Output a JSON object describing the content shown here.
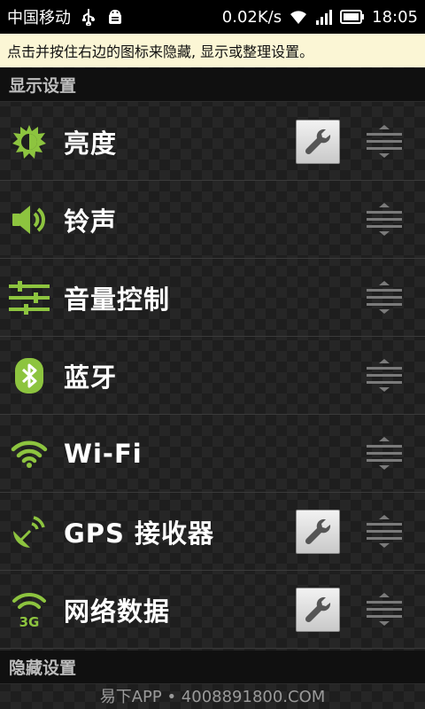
{
  "status_bar": {
    "carrier": "中国移动",
    "usb_icon": "usb-icon",
    "debug_icon": "android-debug-icon",
    "net_speed": "0.02K/s",
    "wifi_icon": "wifi-signal-icon",
    "signal_icon": "cell-signal-icon",
    "battery_icon": "battery-icon",
    "time": "18:05"
  },
  "hint": "点击并按住右边的图标来隐藏, 显示或整理设置。",
  "sections": {
    "display": "显示设置",
    "hidden": "隐藏设置"
  },
  "items": [
    {
      "label": "亮度",
      "icon": "brightness-icon",
      "has_settings": true
    },
    {
      "label": "铃声",
      "icon": "volume-icon",
      "has_settings": false
    },
    {
      "label": "音量控制",
      "icon": "volume-sliders-icon",
      "has_settings": false
    },
    {
      "label": "蓝牙",
      "icon": "bluetooth-icon",
      "has_settings": false
    },
    {
      "label": "Wi-Fi",
      "icon": "wifi-icon",
      "has_settings": false
    },
    {
      "label": "GPS 接收器",
      "icon": "gps-dish-icon",
      "has_settings": true
    },
    {
      "label": "网络数据",
      "icon": "3g-data-icon",
      "has_settings": true
    }
  ],
  "watermark": "易下APP • 4008891800.COM",
  "colors": {
    "accent_green": "#8dc43f",
    "hint_background": "#fbf6d5",
    "header_background": "#101010"
  }
}
